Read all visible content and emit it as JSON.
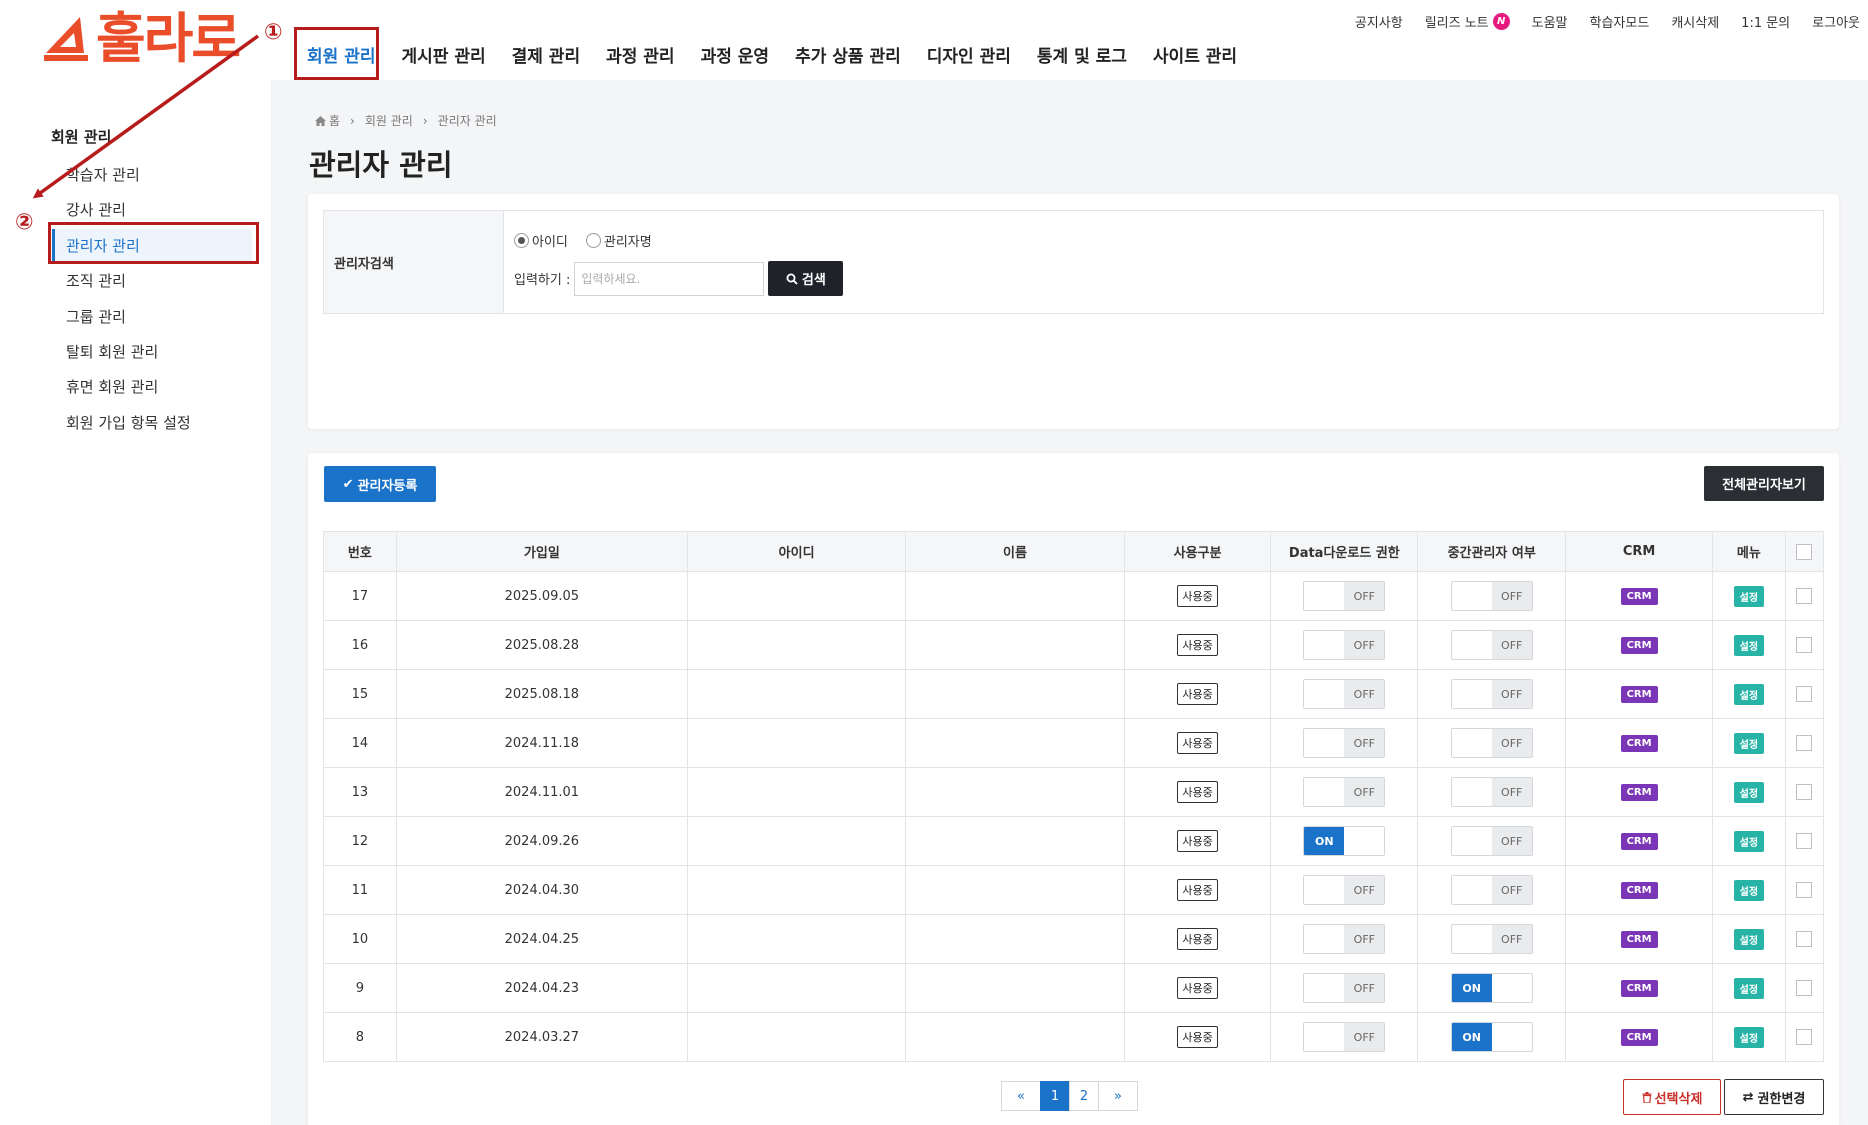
{
  "logo": {
    "text": "훌라로"
  },
  "nav": {
    "items": [
      "회원 관리",
      "게시판 관리",
      "결제 관리",
      "과정 관리",
      "과정 운영",
      "추가 상품 관리",
      "디자인 관리",
      "통계 및 로그",
      "사이트 관리"
    ],
    "active_index": 0
  },
  "util": {
    "notice": "공지사항",
    "release_note": "릴리즈 노트",
    "release_badge": "N",
    "help": "도움말",
    "learner_mode": "학습자모드",
    "cache_delete": "캐시삭제",
    "inquiry": "1:1 문의",
    "logout": "로그아웃"
  },
  "sidebar": {
    "title": "회원 관리",
    "items": [
      "학습자 관리",
      "강사 관리",
      "관리자 관리",
      "조직 관리",
      "그룹 관리",
      "탈퇴 회원 관리",
      "휴면 회원 관리",
      "회원 가입 항목 설정"
    ],
    "active_index": 2
  },
  "breadcrumb": {
    "home": "홈",
    "level1": "회원 관리",
    "level2": "관리자 관리"
  },
  "page_title": "관리자 관리",
  "search": {
    "label": "관리자검색",
    "radio_id": "아이디",
    "radio_name": "관리자명",
    "selected": "아이디",
    "input_label": "입력하기 :",
    "placeholder": "입력하세요.",
    "button": "검색"
  },
  "buttons": {
    "register": "관리자등록",
    "view_all": "전체관리자보기",
    "delete_selected": "선택삭제",
    "change_permission": "권한변경"
  },
  "table": {
    "columns": [
      "번호",
      "가입일",
      "아이디",
      "이름",
      "사용구분",
      "Data다운로드 권한",
      "중간관리자 여부",
      "CRM",
      "메뉴"
    ],
    "status_label": "사용중",
    "crm_label": "CRM",
    "menu_label": "설정",
    "on_label": "ON",
    "off_label": "OFF",
    "rows": [
      {
        "no": "17",
        "date": "2025.09.05",
        "id": "",
        "name": "",
        "data_download": false,
        "mid_admin": false
      },
      {
        "no": "16",
        "date": "2025.08.28",
        "id": "",
        "name": "",
        "data_download": false,
        "mid_admin": false
      },
      {
        "no": "15",
        "date": "2025.08.18",
        "id": "",
        "name": "",
        "data_download": false,
        "mid_admin": false
      },
      {
        "no": "14",
        "date": "2024.11.18",
        "id": "",
        "name": "",
        "data_download": false,
        "mid_admin": false
      },
      {
        "no": "13",
        "date": "2024.11.01",
        "id": "",
        "name": "",
        "data_download": false,
        "mid_admin": false
      },
      {
        "no": "12",
        "date": "2024.09.26",
        "id": "",
        "name": "",
        "data_download": true,
        "mid_admin": false
      },
      {
        "no": "11",
        "date": "2024.04.30",
        "id": "",
        "name": "",
        "data_download": false,
        "mid_admin": false
      },
      {
        "no": "10",
        "date": "2024.04.25",
        "id": "",
        "name": "",
        "data_download": false,
        "mid_admin": false
      },
      {
        "no": "9",
        "date": "2024.04.23",
        "id": "",
        "name": "",
        "data_download": false,
        "mid_admin": true
      },
      {
        "no": "8",
        "date": "2024.03.27",
        "id": "",
        "name": "",
        "data_download": false,
        "mid_admin": true
      }
    ]
  },
  "pagination": {
    "prev": "«",
    "pages": [
      "1",
      "2"
    ],
    "current": "1",
    "next": "»"
  },
  "annotations": {
    "step1": "①",
    "step2": "②"
  },
  "colors": {
    "accent": "#1a73c9",
    "brand": "#ea4d2a",
    "crm": "#7b35b7",
    "menu": "#27b3a6",
    "annotation": "#b71c1c"
  },
  "icons": {
    "home": "home-icon",
    "search": "search-icon",
    "check": "check-icon",
    "trash": "trash-icon",
    "exchange": "exchange-icon"
  }
}
